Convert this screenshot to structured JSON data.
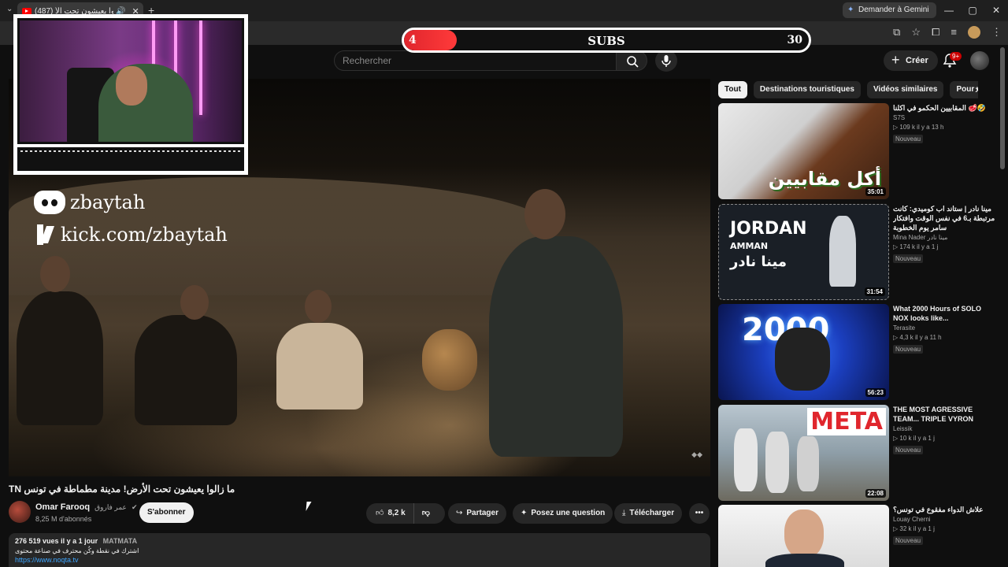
{
  "browser": {
    "tab": {
      "title": "(487) ما زالوا يعيشون تحت الأ",
      "close": "✕"
    },
    "new_tab": "+",
    "ask_gemini": "Demander à Gemini",
    "window_controls": [
      "—",
      "▢",
      "✕"
    ]
  },
  "overlay": {
    "subs_goal": {
      "current": "4",
      "label": "SUBS",
      "goal": "30",
      "progress": 0.13
    },
    "socials": [
      {
        "icon": "discord-icon",
        "text": "zbaytah"
      },
      {
        "icon": "kick-icon",
        "text": "kick.com/zbaytah"
      }
    ]
  },
  "youtube_header": {
    "search_placeholder": "Rechercher",
    "create_label": "Créer",
    "notifications_badge": "9+"
  },
  "video": {
    "title": "TN ما زالوا يعيشون تحت الأرض! مدينة مطماطة في تونس",
    "channel_name": "Omar Farooq",
    "channel_alias": "عمر فاروق",
    "subscribers": "8,25 M d'abonnés",
    "subscribe_label": "S'abonner",
    "likes": "8,2 k",
    "share_label": "Partager",
    "ask_label": "Posez une question",
    "download_label": "Télécharger",
    "more_label": "•••",
    "description": {
      "views": "276 519 vues",
      "date": "il y a 1 jour",
      "tag": "MATMATA",
      "line1": "اشترك في نقطة وكُن محترف في صناعة محتوى",
      "link": "https://www.noqta.tv"
    }
  },
  "sidebar": {
    "chips": [
      "Tout",
      "Destinations touristiques",
      "Vidéos similaires",
      "Pour vous"
    ],
    "recommendations": [
      {
        "title": "المقابيين الحكمو في اكلنا 🥩🤣",
        "channel": "S7S",
        "stats": "▷ 109 k   il y a 13 h",
        "badge": "Nouveau",
        "duration": "35:01",
        "thumb_text": "أكل مقابيين"
      },
      {
        "title": "مينا نادر | ستاند اب كوميدي: كانت مرتبطة بـ6 في نفس الوقت وافتكار سامر يوم الخطوبة",
        "channel": "Mina Nader مينا نادر",
        "stats": "▷ 174 k   il y a 1 j",
        "badge": "Nouveau",
        "duration": "31:54",
        "thumb_text": "JORDAN",
        "thumb_sub": "AMMAN",
        "thumb_arabic": "مينا نادر"
      },
      {
        "title": "What 2000 Hours of SOLO NOX looks like...",
        "channel": "Terasite",
        "stats": "▷ 4,3 k   il y a 11 h",
        "badge": "Nouveau",
        "duration": "56:23",
        "thumb_text": "2000"
      },
      {
        "title": "THE MOST AGRESSIVE TEAM... TRIPLE VYRON",
        "channel": "Leissik",
        "stats": "▷ 10 k   il y a 1 j",
        "badge": "Nouveau",
        "duration": "22:08",
        "thumb_text": "META"
      },
      {
        "title": "علاش الدواء مفقوع في تونس؟",
        "channel": "Louay Cherni",
        "stats": "▷ 32 k   il y a 1 j",
        "badge": "Nouveau",
        "duration": "",
        "thumb_text": ""
      }
    ]
  }
}
